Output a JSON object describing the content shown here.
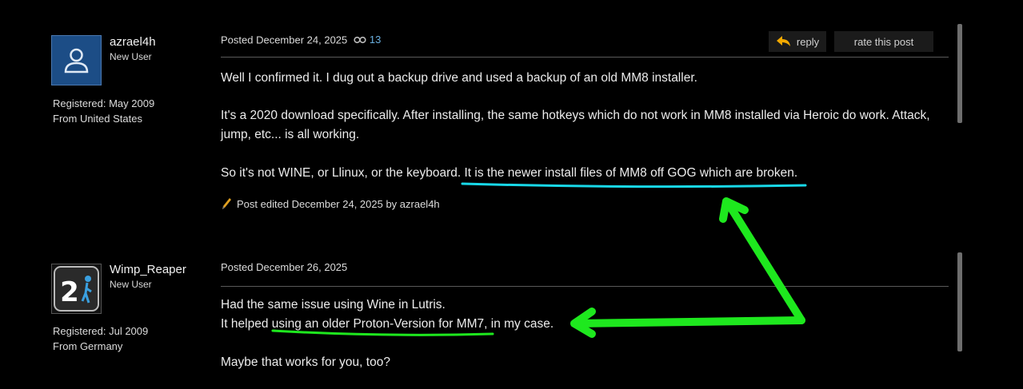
{
  "posts": [
    {
      "author": "azrael4h",
      "role": "New User",
      "registered": "Registered: May 2009",
      "from": "From United States",
      "posted": "Posted December 24, 2025",
      "views": "13",
      "reply_label": "reply",
      "rate_label": "rate this post",
      "paragraphs": [
        "Well I confirmed it. I dug out a backup drive and used a backup of an old MM8 installer.",
        "It's a 2020 download specifically. After installing, the same hotkeys which do not work in MM8 installed via Heroic do work. Attack, jump, etc... is all working."
      ],
      "p3_pre": "So it's not WINE, or Llinux, or the keyboard.",
      "p3_highlight": "It is the newer install files of MM8 off GOG which are broken.",
      "edited": "Post edited December 24, 2025 by azrael4h"
    },
    {
      "author": "Wimp_Reaper",
      "role": "New User",
      "registered": "Registered: Jul 2009",
      "from": "From Germany",
      "posted": "Posted December 26, 2025",
      "line1": "Had the same issue using Wine in Lutris.",
      "line2_pre": "It helped",
      "line2_highlight": "using an older Proton-Version for MM7,",
      "line2_post": "in my case.",
      "line3": "Maybe that works for you, too?",
      "avatar_text": "2"
    }
  ],
  "colors": {
    "underline_cyan": "#18d8e8",
    "annotation_green": "#1ee81e",
    "views": "#6ab0e0"
  }
}
